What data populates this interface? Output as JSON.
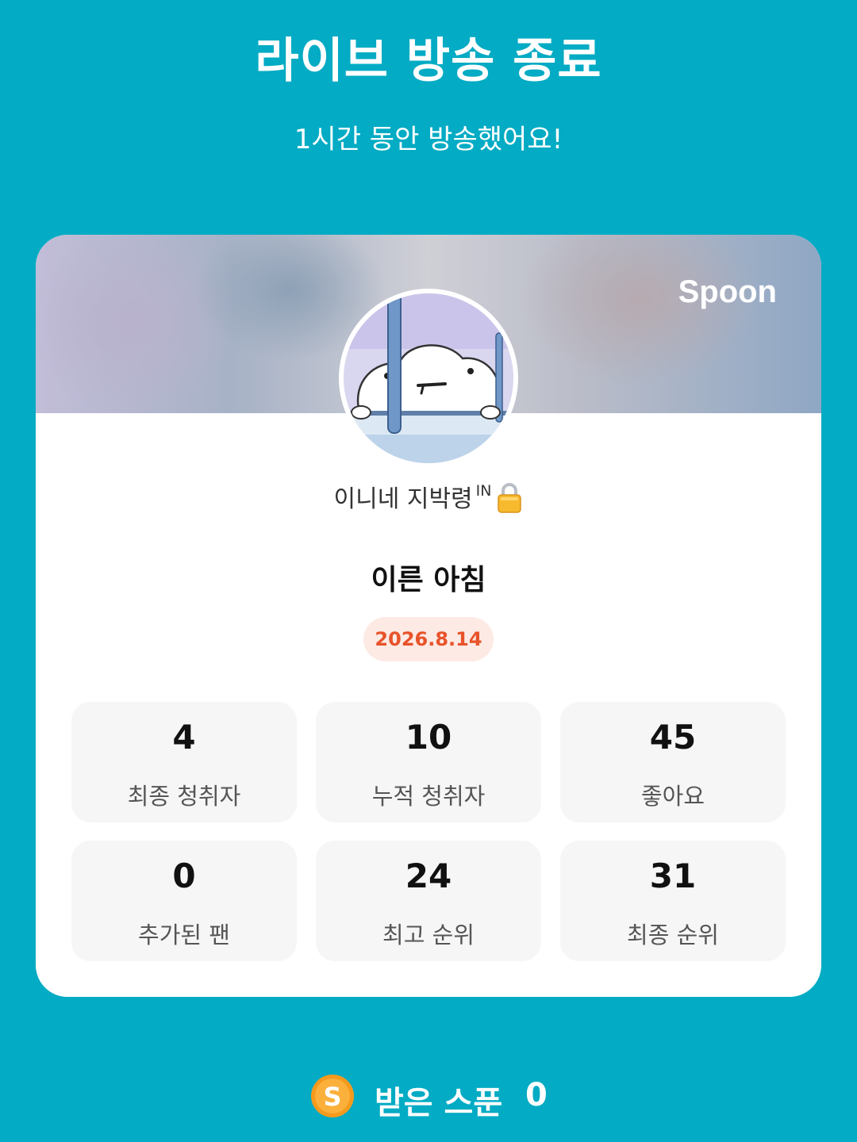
{
  "header": {
    "title": "라이브 방송 종료",
    "subtitle": "1시간 동안 방송했어요!"
  },
  "card": {
    "brand": "Spoon",
    "username": "이니네 지박령",
    "username_badge": "IN",
    "room_title": "이른 아침",
    "date": "2026.8.14",
    "stats": [
      {
        "value": "4",
        "label": "최종 청취자"
      },
      {
        "value": "10",
        "label": "누적 청취자"
      },
      {
        "value": "45",
        "label": "좋아요"
      },
      {
        "value": "0",
        "label": "추가된 팬"
      },
      {
        "value": "24",
        "label": "최고 순위"
      },
      {
        "value": "31",
        "label": "최종 순위"
      }
    ]
  },
  "footer": {
    "label": "받은 스푼",
    "count": "0",
    "coin_letter": "S"
  },
  "colors": {
    "background": "#03abc4",
    "date_text": "#e8532a",
    "date_bg": "#fdeae4",
    "coin": "#f59a1d"
  },
  "icons": [
    "lock-icon",
    "spoon-coin-icon"
  ]
}
